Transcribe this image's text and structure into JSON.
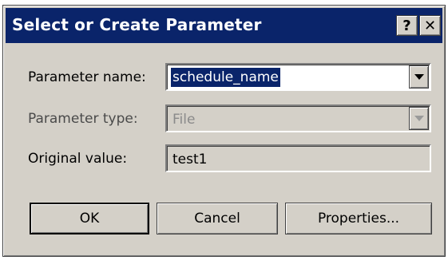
{
  "window": {
    "title": "Select or Create Parameter",
    "help_label": "?",
    "close_label": "✕"
  },
  "form": {
    "parameter_name": {
      "label": "Parameter name:",
      "value": "schedule_name"
    },
    "parameter_type": {
      "label": "Parameter type:",
      "value": "File"
    },
    "original_value": {
      "label": "Original value:",
      "value": "test1"
    }
  },
  "buttons": {
    "ok": "OK",
    "cancel": "Cancel",
    "properties": "Properties..."
  },
  "colors": {
    "titlebar": "#0a246a",
    "face": "#d4d0c8",
    "selection": "#0a246a"
  }
}
